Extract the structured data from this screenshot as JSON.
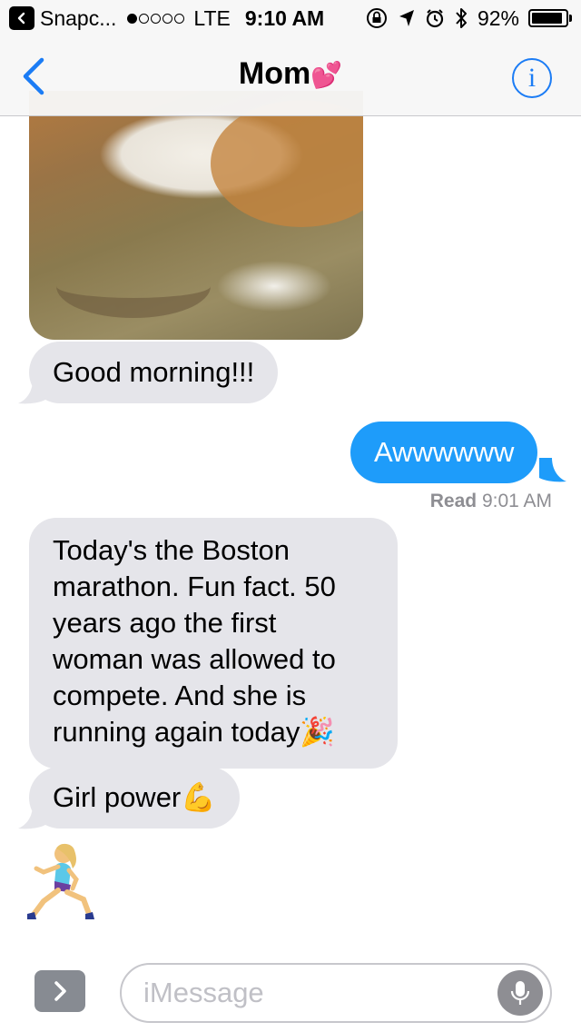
{
  "status_bar": {
    "back_app": "Snapc...",
    "carrier_signal": "●○○○○",
    "network": "LTE",
    "time": "9:10 AM",
    "battery_percent": "92%",
    "battery_level": 0.92
  },
  "nav": {
    "title": "Mom",
    "title_emoji": "💕",
    "info_label": "i"
  },
  "messages": [
    {
      "sender": "incoming",
      "type": "image",
      "icon": "cat-photo"
    },
    {
      "sender": "incoming",
      "text": "Good morning!!!"
    },
    {
      "sender": "outgoing",
      "text": "Awwwwww"
    },
    {
      "sender": "incoming",
      "lines": [
        "Today's the Boston",
        "marathon. Fun fact. 50",
        "years ago the first",
        "woman was allowed to",
        "compete. And she is",
        "running again today"
      ],
      "emoji": "🎉"
    },
    {
      "sender": "incoming",
      "text": "Girl power",
      "emoji": "💪"
    },
    {
      "sender": "incoming",
      "type": "emoji",
      "icon": "woman-running-emoji"
    }
  ],
  "read_receipt": {
    "label": "Read",
    "time": "9:01 AM"
  },
  "input": {
    "placeholder": "iMessage"
  },
  "colors": {
    "accent": "#1b7cf5",
    "outgoing_bubble": "#1e9cfa",
    "incoming_bubble": "#e5e5ea"
  }
}
